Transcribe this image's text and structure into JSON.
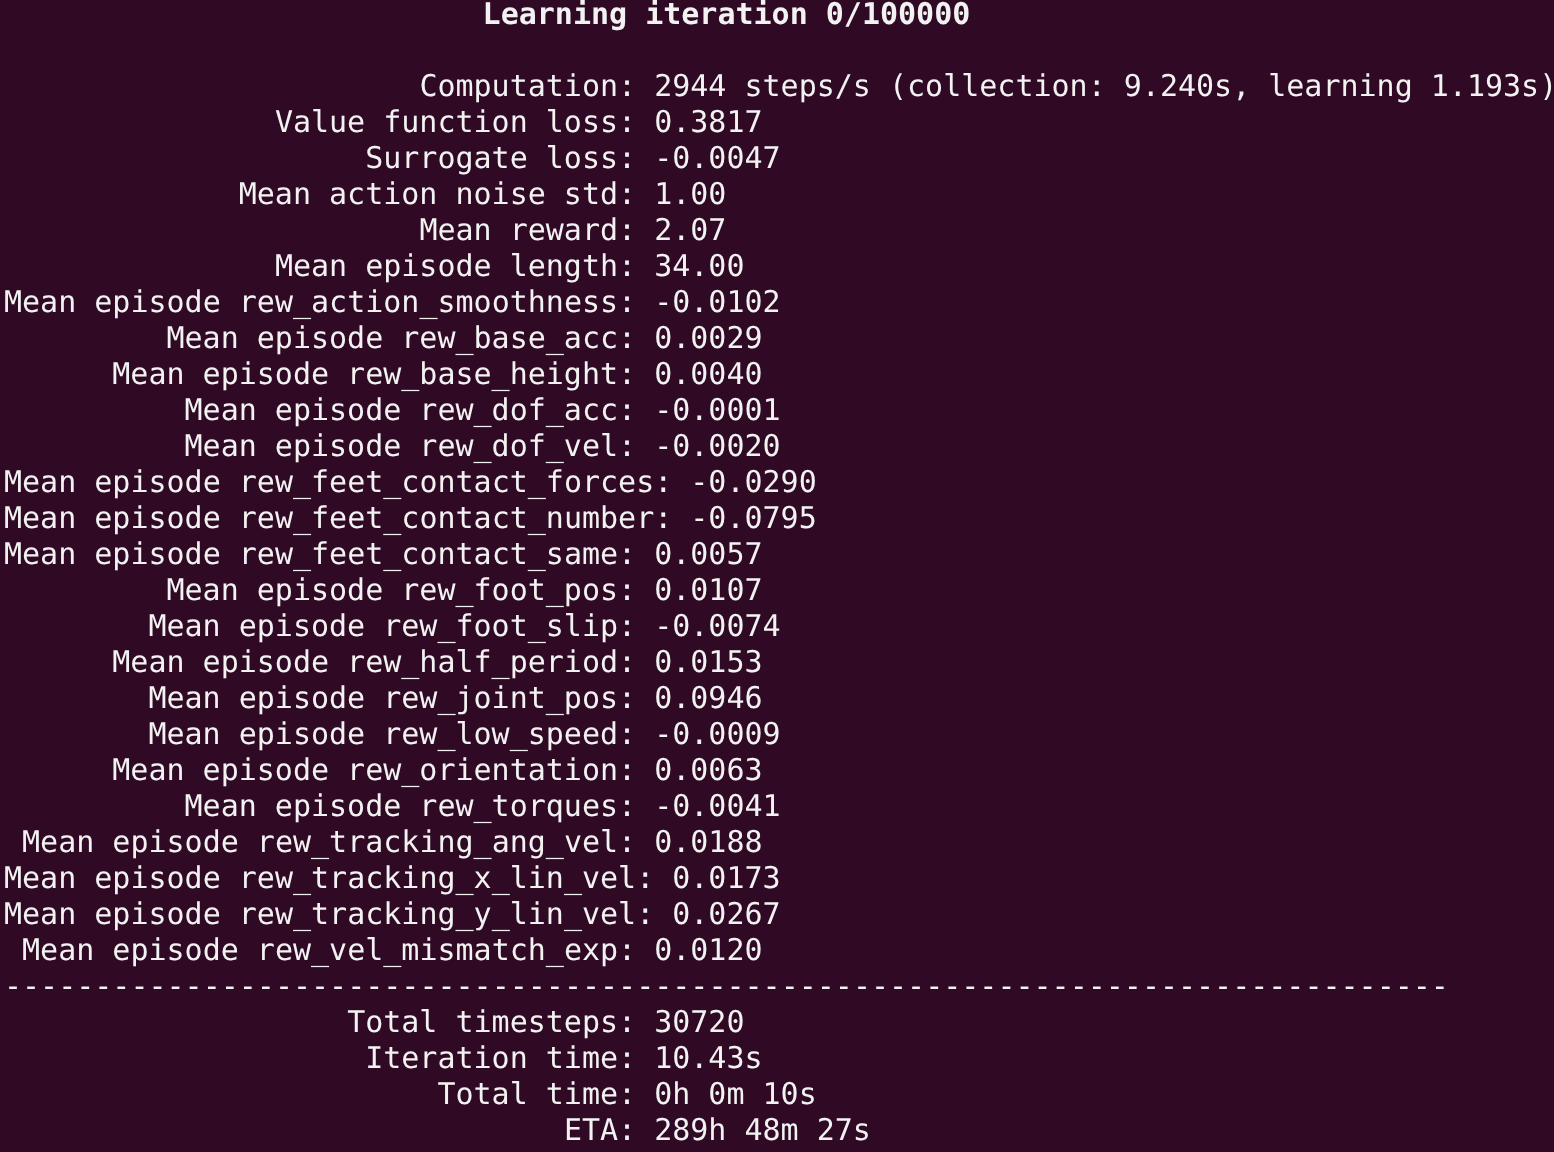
{
  "title": "Learning iteration 0/100000",
  "stats": [
    {
      "label": "Computation:",
      "value": "2944 steps/s (collection: 9.240s, learning 1.193s)"
    },
    {
      "label": "Value function loss:",
      "value": "0.3817"
    },
    {
      "label": "Surrogate loss:",
      "value": "-0.0047"
    },
    {
      "label": "Mean action noise std:",
      "value": "1.00"
    },
    {
      "label": "Mean reward:",
      "value": "2.07"
    },
    {
      "label": "Mean episode length:",
      "value": "34.00"
    },
    {
      "label": "Mean episode rew_action_smoothness:",
      "value": "-0.0102"
    },
    {
      "label": "Mean episode rew_base_acc:",
      "value": "0.0029"
    },
    {
      "label": "Mean episode rew_base_height:",
      "value": "0.0040"
    },
    {
      "label": "Mean episode rew_dof_acc:",
      "value": "-0.0001"
    },
    {
      "label": "Mean episode rew_dof_vel:",
      "value": "-0.0020"
    },
    {
      "label": "Mean episode rew_feet_contact_forces:",
      "value": "-0.0290"
    },
    {
      "label": "Mean episode rew_feet_contact_number:",
      "value": "-0.0795"
    },
    {
      "label": "Mean episode rew_feet_contact_same:",
      "value": "0.0057"
    },
    {
      "label": "Mean episode rew_foot_pos:",
      "value": "0.0107"
    },
    {
      "label": "Mean episode rew_foot_slip:",
      "value": "-0.0074"
    },
    {
      "label": "Mean episode rew_half_period:",
      "value": "0.0153"
    },
    {
      "label": "Mean episode rew_joint_pos:",
      "value": "0.0946"
    },
    {
      "label": "Mean episode rew_low_speed:",
      "value": "-0.0009"
    },
    {
      "label": "Mean episode rew_orientation:",
      "value": "0.0063"
    },
    {
      "label": "Mean episode rew_torques:",
      "value": "-0.0041"
    },
    {
      "label": "Mean episode rew_tracking_ang_vel:",
      "value": "0.0188"
    },
    {
      "label": "Mean episode rew_tracking_x_lin_vel:",
      "value": "0.0173"
    },
    {
      "label": "Mean episode rew_tracking_y_lin_vel:",
      "value": "0.0267"
    },
    {
      "label": "Mean episode rew_vel_mismatch_exp:",
      "value": "0.0120"
    }
  ],
  "separator": "--------------------------------------------------------------------------------",
  "summary": [
    {
      "label": "Total timesteps:",
      "value": "30720"
    },
    {
      "label": "Iteration time:",
      "value": "10.43s"
    },
    {
      "label": "Total time:",
      "value": "0h 0m 10s"
    },
    {
      "label": "ETA:",
      "value": "289h 48m 27s"
    }
  ]
}
